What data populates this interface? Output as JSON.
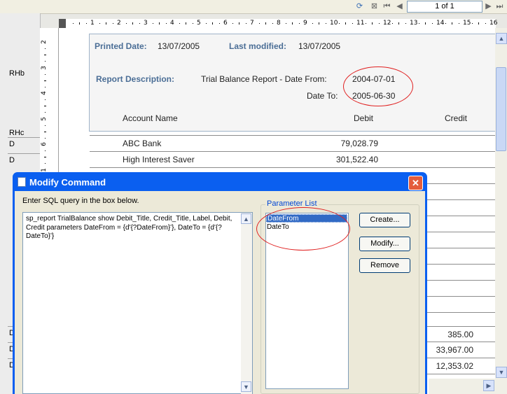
{
  "toolbar": {
    "page_indicator": "1 of 1",
    "icons": [
      "refresh-icon",
      "export-icon",
      "first-page-icon",
      "previous-page-icon",
      "next-page-icon",
      "last-page-icon"
    ]
  },
  "sections": {
    "rhb": "RHb",
    "rhc": "RHc",
    "d": "D"
  },
  "ruler": {
    "horizontal": [
      "1",
      "2",
      "3",
      "4",
      "5",
      "6",
      "7",
      "8",
      "9",
      "10",
      "11",
      "12",
      "13",
      "14",
      "15",
      "16"
    ],
    "vertical": [
      "2",
      "3",
      "4",
      "5",
      "6",
      "1"
    ]
  },
  "report": {
    "printed_date_label": "Printed Date:",
    "printed_date": "13/07/2005",
    "last_modified_label": "Last modified:",
    "last_modified": "13/07/2005",
    "description_label": "Report Description:",
    "description_text": "Trial Balance Report - Date From:",
    "date_from": "2004-07-01",
    "date_to_label": "Date To:",
    "date_to": "2005-06-30",
    "col_account": "Account Name",
    "col_debit": "Debit",
    "col_credit": "Credit",
    "rows": [
      {
        "account": "ABC Bank",
        "debit": "79,028.79"
      },
      {
        "account": "High Interest Saver",
        "debit": "301,522.40"
      }
    ],
    "right_values": [
      "385.00",
      "33,967.00",
      "12,353.02"
    ]
  },
  "dialog": {
    "title": "Modify Command",
    "close": "✕",
    "sql_label": "Enter SQL query in the box below.",
    "sql_text": "sp_report TrialBalance show Debit_Title, Credit_Title, Label, Debit, Credit parameters DateFrom = {d'{?DateFrom}'}, DateTo = {d'{?DateTo}'}",
    "param_legend": "Parameter List",
    "params": [
      "DateFrom",
      "DateTo"
    ],
    "buttons": {
      "create": "Create...",
      "modify": "Modify...",
      "remove": "Remove"
    }
  },
  "colors": {
    "accent_blue": "#4b6e96",
    "title_bar": "#0a5ff0",
    "highlight": "#e02020"
  }
}
